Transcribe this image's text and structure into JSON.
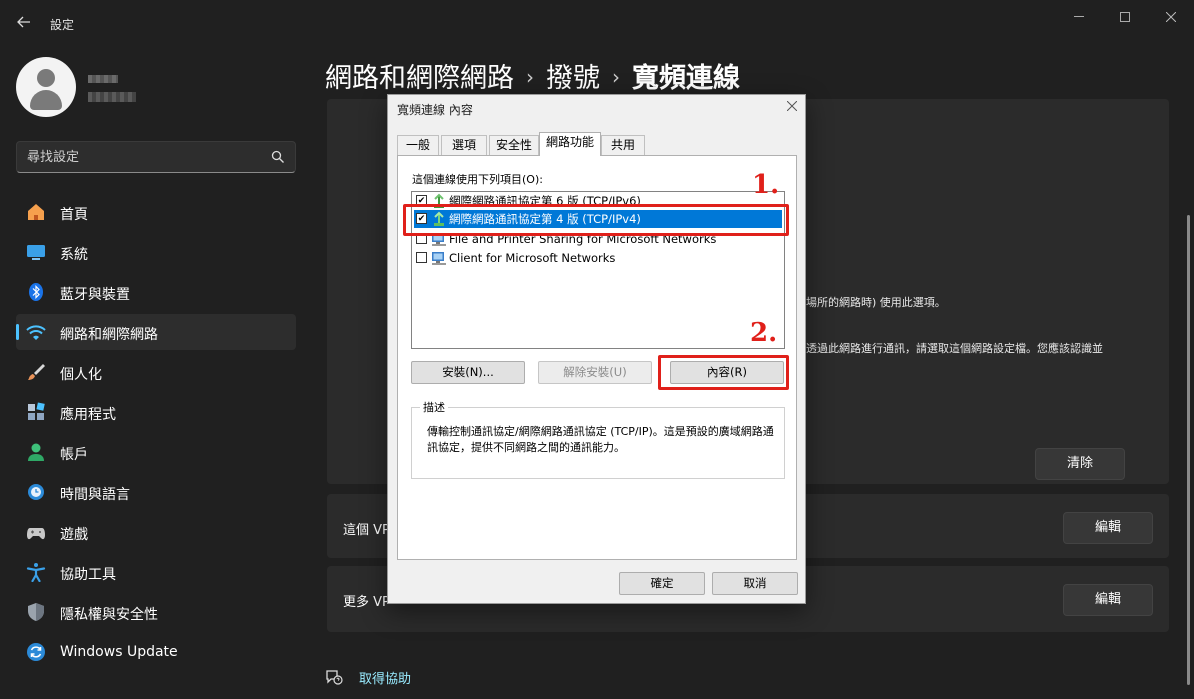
{
  "window": {
    "title": "設定"
  },
  "sidebar": {
    "search_placeholder": "尋找設定",
    "items": [
      {
        "label": "首頁",
        "icon": "home-icon"
      },
      {
        "label": "系統",
        "icon": "system-icon"
      },
      {
        "label": "藍牙與裝置",
        "icon": "bluetooth-icon"
      },
      {
        "label": "網路和網際網路",
        "icon": "network-icon",
        "active": true
      },
      {
        "label": "個人化",
        "icon": "brush-icon"
      },
      {
        "label": "應用程式",
        "icon": "apps-icon"
      },
      {
        "label": "帳戶",
        "icon": "account-icon"
      },
      {
        "label": "時間與語言",
        "icon": "clock-globe-icon"
      },
      {
        "label": "遊戲",
        "icon": "gamepad-icon"
      },
      {
        "label": "協助工具",
        "icon": "accessibility-icon"
      },
      {
        "label": "隱私權與安全性",
        "icon": "shield-icon"
      },
      {
        "label": "Windows Update",
        "icon": "update-icon"
      }
    ]
  },
  "breadcrumb": {
    "items": [
      "網路和網際網路",
      "撥號",
      "寬頻連線"
    ],
    "separator": "›"
  },
  "main": {
    "partial_text_1": "場所的網路時) 使用此選項。",
    "partial_text_2": "透過此網路進行通訊，請選取這個網路設定檔。您應該認識並",
    "clear_button": "清除",
    "vpn_row_1": {
      "label": "這個 VP",
      "button": "編輯"
    },
    "vpn_row_2": {
      "label": "更多 VP",
      "button": "編輯"
    },
    "help_link": "取得協助"
  },
  "dialog": {
    "title": "寬頻連線 內容",
    "tabs": [
      "一般",
      "選項",
      "安全性",
      "網路功能",
      "共用"
    ],
    "active_tab": "網路功能",
    "list_label": "這個連線使用下列項目(O):",
    "items": [
      {
        "label": "網際網路通訊協定第 6 版 (TCP/IPv6)",
        "checked": true,
        "selected": false
      },
      {
        "label": "網際網路通訊協定第 4 版 (TCP/IPv4)",
        "checked": true,
        "selected": true
      },
      {
        "label": "File and Printer Sharing for Microsoft Networks",
        "checked": false,
        "selected": false
      },
      {
        "label": "Client for Microsoft Networks",
        "checked": false,
        "selected": false
      }
    ],
    "buttons": {
      "install": "安裝(N)...",
      "uninstall": "解除安裝(U)",
      "properties": "內容(R)"
    },
    "description": {
      "legend": "描述",
      "text": "傳輸控制通訊協定/網際網路通訊協定 (TCP/IP)。這是預設的廣域網路通訊協定，提供不同網路之間的通訊能力。"
    },
    "ok": "確定",
    "cancel": "取消"
  },
  "annotations": {
    "step1": "1.",
    "step2": "2.",
    "color": "#e0201a"
  },
  "colors": {
    "accent": "#4cc2ff",
    "selection": "#0078d7",
    "link": "#99ebff"
  }
}
